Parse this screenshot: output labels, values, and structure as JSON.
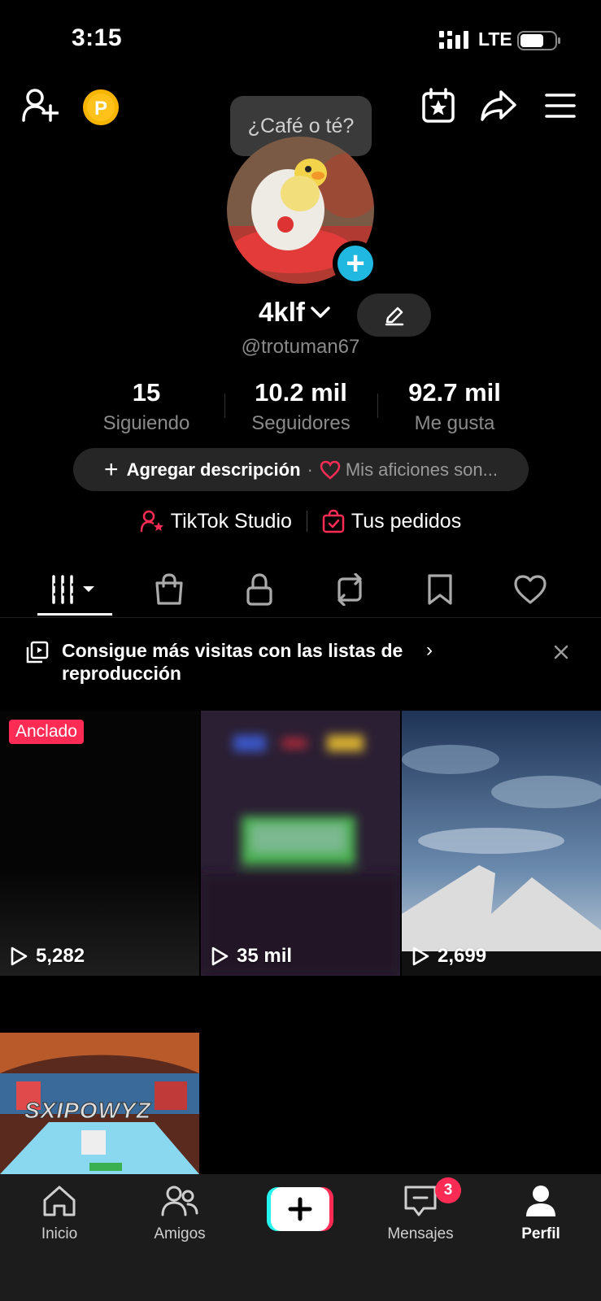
{
  "status": {
    "time": "3:15",
    "network": "LTE"
  },
  "tooltip": {
    "text": "¿Café o té?"
  },
  "profile": {
    "username": "4klf",
    "handle": "@trotuman67"
  },
  "stats": [
    {
      "value": "15",
      "label": "Siguiendo"
    },
    {
      "value": "10.2 mil",
      "label": "Seguidores"
    },
    {
      "value": "92.7 mil",
      "label": "Me gusta"
    }
  ],
  "description": {
    "add_label": "Agregar descripción",
    "separator": "·",
    "hobby_label": "Mis aficiones son..."
  },
  "links": {
    "studio": "TikTok Studio",
    "orders": "Tus pedidos"
  },
  "tabs": [
    {
      "name": "videos",
      "icon": "grid-icon"
    },
    {
      "name": "shop",
      "icon": "shopping-bag-icon"
    },
    {
      "name": "private",
      "icon": "lock-icon"
    },
    {
      "name": "reposts",
      "icon": "repost-icon"
    },
    {
      "name": "saved",
      "icon": "bookmark-icon"
    },
    {
      "name": "liked",
      "icon": "heart-icon"
    }
  ],
  "banner": {
    "text": "Consigue más visitas con las listas de reproducción",
    "chevron": "›",
    "close": "×"
  },
  "videos": [
    {
      "views": "5,282",
      "pinned_label": "Anclado"
    },
    {
      "views": "35 mil"
    },
    {
      "views": "2,699"
    },
    {
      "views": "",
      "overlay_text": "SXIPOWYZ"
    }
  ],
  "bottom_nav": {
    "home": "Inicio",
    "friends": "Amigos",
    "messages": "Mensajes",
    "messages_badge": "3",
    "profile": "Perfil"
  },
  "colors": {
    "accent_red": "#fe2c55",
    "accent_cyan": "#20b8e0",
    "background": "#000000"
  }
}
